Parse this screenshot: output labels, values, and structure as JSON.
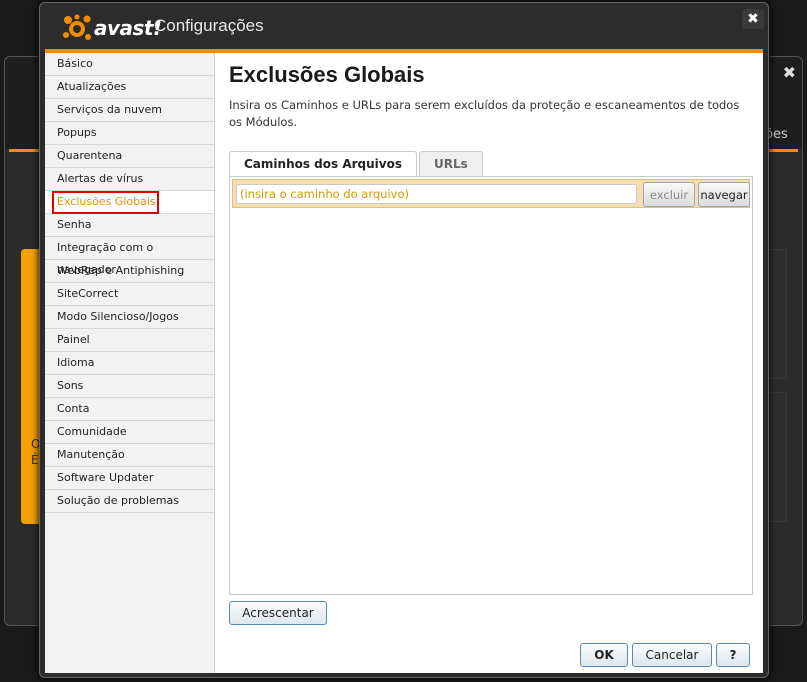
{
  "window": {
    "brand": "avast!",
    "title": "Configurações",
    "close_glyph": "✖",
    "colors": {
      "accent": "#f28c00",
      "selection_outline": "#e00000"
    }
  },
  "background": {
    "close_glyph": "✖",
    "tab_fragment": "ões",
    "panel_text_1": "O",
    "panel_text_2": "É r"
  },
  "sidebar": {
    "items": [
      "Básico",
      "Atualizações",
      "Serviços da nuvem",
      "Popups",
      "Quarentena",
      "Alertas de vírus",
      "Exclusões Globais",
      "Senha",
      "Integração com o navegador",
      "WebRep e Antiphishing",
      "SiteCorrect",
      "Modo Silencioso/Jogos",
      "Painel",
      "Idioma",
      "Sons",
      "Conta",
      "Comunidade",
      "Manutenção",
      "Software Updater",
      "Solução de problemas"
    ],
    "selected_index": 6
  },
  "main": {
    "title": "Exclusões Globais",
    "description": "Insira os Caminhos e URLs para serem excluídos da proteção e escaneamentos de todos os Módulos.",
    "tabs": [
      {
        "label": "Caminhos dos Arquivos",
        "active": true
      },
      {
        "label": "URLs",
        "active": false
      }
    ],
    "path_input": {
      "value": "",
      "placeholder": "(insira o caminho do arquivo)"
    },
    "exclude_button": "excluir",
    "browse_button": "navegar",
    "add_button": "Acrescentar"
  },
  "footer": {
    "ok": "OK",
    "cancel": "Cancelar",
    "help": "?"
  }
}
